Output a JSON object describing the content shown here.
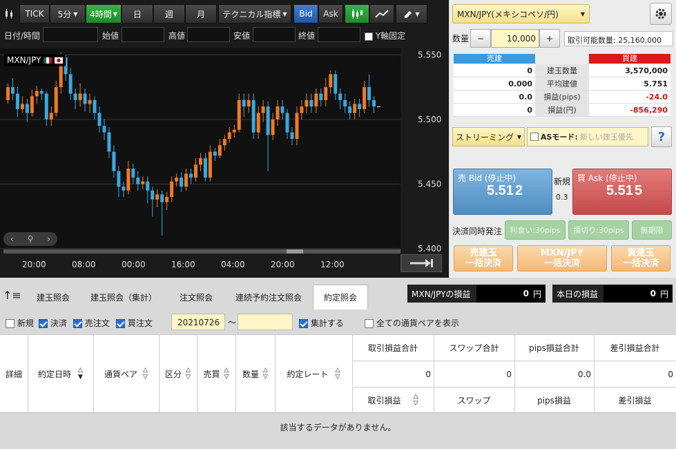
{
  "toolbar": {
    "tick": "TICK",
    "interval": "5分",
    "interval_active": "4時間",
    "day": "日",
    "week": "週",
    "month": "月",
    "tech": "テクニカル指標",
    "bid": "Bid",
    "ask": "Ask"
  },
  "ohlc": {
    "datetime": "日付/時間",
    "open": "始値",
    "high": "高値",
    "low": "安値",
    "close": "終値",
    "yfix": "Y軸固定"
  },
  "chart": {
    "pair": "MXN/JPY",
    "y_labels": [
      "5.550",
      "5.500",
      "5.450",
      "5.400"
    ],
    "x_labels": [
      "20:00",
      "08:00",
      "00:00",
      "16:00",
      "04:00",
      "20:00",
      "12:00"
    ]
  },
  "chart_data": {
    "type": "candlestick",
    "ylim": [
      5.4,
      5.555
    ],
    "candles": [
      [
        5.515,
        5.525,
        5.528,
        5.512
      ],
      [
        5.525,
        5.52,
        5.532,
        5.515
      ],
      [
        5.52,
        5.508,
        5.525,
        5.502
      ],
      [
        5.508,
        5.512,
        5.518,
        5.505
      ],
      [
        5.512,
        5.505,
        5.516,
        5.498
      ],
      [
        5.505,
        5.518,
        5.523,
        5.502
      ],
      [
        5.518,
        5.522,
        5.526,
        5.512
      ],
      [
        5.522,
        5.52,
        5.524,
        5.515
      ],
      [
        5.52,
        5.5,
        5.522,
        5.495
      ],
      [
        5.5,
        5.505,
        5.51,
        5.495
      ],
      [
        5.505,
        5.525,
        5.53,
        5.502
      ],
      [
        5.525,
        5.548,
        5.552,
        5.52
      ],
      [
        5.548,
        5.535,
        5.55,
        5.53
      ],
      [
        5.535,
        5.52,
        5.54,
        5.515
      ],
      [
        5.52,
        5.515,
        5.524,
        5.508
      ],
      [
        5.515,
        5.52,
        5.528,
        5.51
      ],
      [
        5.52,
        5.512,
        5.524,
        5.506
      ],
      [
        5.512,
        5.515,
        5.52,
        5.505
      ],
      [
        5.515,
        5.505,
        5.518,
        5.5
      ],
      [
        5.505,
        5.495,
        5.51,
        5.49
      ],
      [
        5.495,
        5.49,
        5.5,
        5.484
      ],
      [
        5.49,
        5.475,
        5.494,
        5.47
      ],
      [
        5.475,
        5.46,
        5.48,
        5.455
      ],
      [
        5.46,
        5.448,
        5.464,
        5.44
      ],
      [
        5.448,
        5.445,
        5.452,
        5.44
      ],
      [
        5.445,
        5.462,
        5.468,
        5.442
      ],
      [
        5.462,
        5.455,
        5.466,
        5.45
      ],
      [
        5.455,
        5.45,
        5.46,
        5.445
      ],
      [
        5.45,
        5.452,
        5.456,
        5.446
      ],
      [
        5.452,
        5.445,
        5.456,
        5.435
      ],
      [
        5.445,
        5.438,
        5.448,
        5.425
      ],
      [
        5.438,
        5.442,
        5.446,
        5.432
      ],
      [
        5.442,
        5.436,
        5.445,
        5.41
      ],
      [
        5.436,
        5.44,
        5.444,
        5.43
      ],
      [
        5.44,
        5.452,
        5.456,
        5.436
      ],
      [
        5.452,
        5.455,
        5.458,
        5.448
      ],
      [
        5.455,
        5.448,
        5.459,
        5.444
      ],
      [
        5.448,
        5.458,
        5.462,
        5.445
      ],
      [
        5.458,
        5.455,
        5.462,
        5.45
      ],
      [
        5.455,
        5.465,
        5.47,
        5.452
      ],
      [
        5.465,
        5.47,
        5.474,
        5.46
      ],
      [
        5.47,
        5.455,
        5.474,
        5.452
      ],
      [
        5.455,
        5.475,
        5.48,
        5.452
      ],
      [
        5.475,
        5.472,
        5.478,
        5.468
      ],
      [
        5.472,
        5.48,
        5.485,
        5.47
      ],
      [
        5.48,
        5.485,
        5.488,
        5.476
      ],
      [
        5.485,
        5.49,
        5.494,
        5.482
      ],
      [
        5.49,
        5.492,
        5.496,
        5.486
      ],
      [
        5.492,
        5.515,
        5.52,
        5.49
      ],
      [
        5.515,
        5.51,
        5.52,
        5.502
      ],
      [
        5.51,
        5.515,
        5.52,
        5.505
      ],
      [
        5.515,
        5.49,
        5.52,
        5.485
      ],
      [
        5.49,
        5.505,
        5.51,
        5.485
      ],
      [
        5.505,
        5.51,
        5.515,
        5.498
      ],
      [
        5.51,
        5.488,
        5.514,
        5.46
      ],
      [
        5.488,
        5.5,
        5.505,
        5.484
      ],
      [
        5.5,
        5.51,
        5.515,
        5.495
      ],
      [
        5.51,
        5.505,
        5.515,
        5.5
      ],
      [
        5.505,
        5.49,
        5.508,
        5.485
      ],
      [
        5.49,
        5.485,
        5.494,
        5.48
      ],
      [
        5.485,
        5.505,
        5.51,
        5.48
      ],
      [
        5.505,
        5.51,
        5.515,
        5.5
      ],
      [
        5.51,
        5.515,
        5.52,
        5.505
      ],
      [
        5.515,
        5.51,
        5.52,
        5.505
      ],
      [
        5.51,
        5.52,
        5.524,
        5.505
      ],
      [
        5.52,
        5.515,
        5.524,
        5.51
      ],
      [
        5.515,
        5.525,
        5.532,
        5.51
      ],
      [
        5.525,
        5.535,
        5.538,
        5.52
      ],
      [
        5.535,
        5.52,
        5.538,
        5.515
      ],
      [
        5.52,
        5.515,
        5.524,
        5.508
      ],
      [
        5.515,
        5.51,
        5.52,
        5.505
      ],
      [
        5.51,
        5.505,
        5.514,
        5.5
      ],
      [
        5.505,
        5.512,
        5.516,
        5.5
      ],
      [
        5.512,
        5.508,
        5.516,
        5.502
      ],
      [
        5.508,
        5.525,
        5.53,
        5.505
      ],
      [
        5.525,
        5.515,
        5.535,
        5.51
      ],
      [
        5.515,
        5.51,
        5.518,
        5.505
      ],
      [
        5.51,
        5.51,
        5.51,
        5.51
      ]
    ]
  },
  "quote": {
    "pair_select": "MXN/JPY(メキシコペソ/円)",
    "qty_label": "数量",
    "minus": "−",
    "qty": "10,000",
    "plus": "+",
    "available": "取引可能数量: 25,160,000"
  },
  "positions": {
    "sell_head": "売建",
    "buy_head": "買建",
    "rows": [
      {
        "sell": "0",
        "label": "建玉数量",
        "buy": "3,570,000"
      },
      {
        "sell": "0.000",
        "label": "平均建値",
        "buy": "5.751"
      },
      {
        "sell": "0.0",
        "label": "損益(pips)",
        "buy": "-24.0"
      },
      {
        "sell": "0",
        "label": "損益(円)",
        "buy": "-856,290"
      }
    ]
  },
  "streaming": {
    "mode": "ストリーミング",
    "as_mode": "ASモード:",
    "as_placeholder": "新しい建玉優先",
    "help": "?"
  },
  "prices": {
    "bid_title": "売 Bid (停止中)",
    "bid_big": "5.51",
    "bid_small": "2",
    "new_label": "新規",
    "spread": "0.3",
    "ask_title": "買 Ask (停止中)",
    "ask_big": "5.51",
    "ask_small": "5"
  },
  "settle": {
    "label": "決済同時発注",
    "take": "利食い:30pips",
    "stop": "損切り:30pips",
    "expiry": "無期限"
  },
  "bulk": {
    "sell1": "売建玉",
    "sell2": "一括決済",
    "pair1": "MXN/JPY",
    "pair2": "一括決済",
    "buy1": "買建玉",
    "buy2": "一括決済"
  },
  "tabs": [
    "建玉照会",
    "建玉照会（集計）",
    "注文照会",
    "連続予約注文照会",
    "約定照会"
  ],
  "pnl": {
    "pair_label": "MXN/JPYの損益",
    "pair_value": "0",
    "today_label": "本日の損益",
    "today_value": "0",
    "unit": "円"
  },
  "filters": {
    "new": "新規",
    "settle": "決済",
    "sell_order": "売注文",
    "buy_order": "買注文",
    "date_from": "20210726",
    "tilde": "〜",
    "aggregate": "集計する",
    "all_pairs": "全ての通貨ペアを表示"
  },
  "grid": {
    "detail": "詳細",
    "date": "約定日時",
    "pair": "通貨ペア",
    "kind": "区分",
    "side": "売買",
    "qty": "数量",
    "rate": "約定レート",
    "sum_pnl": "取引損益合計",
    "sum_swap": "スワップ合計",
    "sum_pips": "pips損益合計",
    "sum_net": "差引損益合計",
    "v_pnl": "0",
    "v_swap": "0",
    "v_pips": "0.0",
    "v_net": "0",
    "pnl": "取引損益",
    "swap": "スワップ",
    "pips": "pips損益",
    "net": "差引損益"
  },
  "empty_message": "該当するデータがありません。"
}
